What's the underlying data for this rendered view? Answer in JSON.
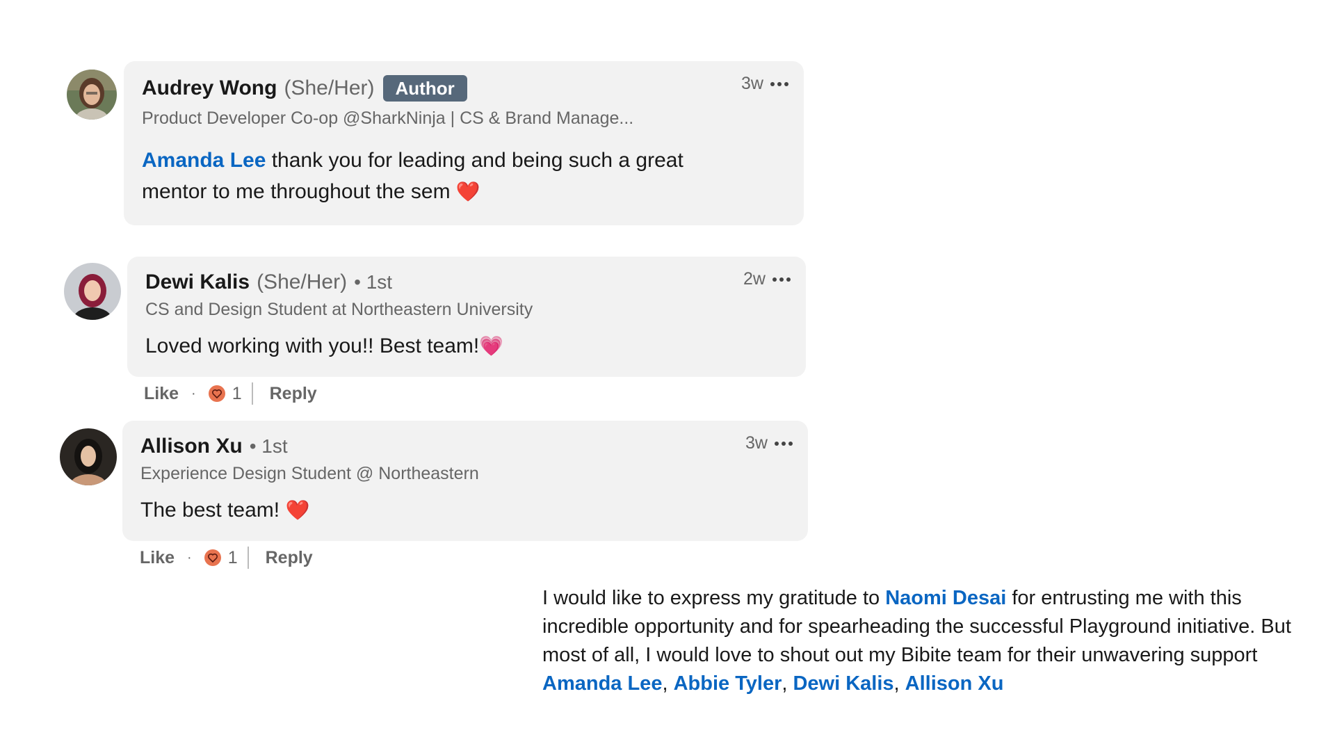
{
  "comments": [
    {
      "name": "Audrey Wong",
      "pronouns": "(She/Her)",
      "badge": "Author",
      "headline": "Product Developer Co-op @SharkNinja | CS & Brand Manage...",
      "time": "3w",
      "mention": "Amanda Lee",
      "text_line1": " thank you for leading and being such a great",
      "text_line2": "mentor to me throughout the sem ",
      "emoji": "❤️"
    },
    {
      "name": "Dewi Kalis",
      "pronouns": "(She/Her)",
      "degree": "• 1st",
      "headline": "CS and Design Student at Northeastern University",
      "time": "2w",
      "text": "Loved working with you!! Best team!",
      "emoji": "💗",
      "like_label": "Like",
      "dot": "·",
      "reaction_count": "1",
      "reply_label": "Reply"
    },
    {
      "name": "Allison Xu",
      "degree": "• 1st",
      "headline": "Experience Design Student @ Northeastern",
      "time": "3w",
      "text": "The best team! ",
      "emoji": "❤️",
      "like_label": "Like",
      "dot": "·",
      "reaction_count": "1",
      "reply_label": "Reply"
    }
  ],
  "post": {
    "part1": "I would like to express my gratitude to ",
    "mention1": "Naomi Desai",
    "part2": " for entrusting me with this incredible opportunity and for spearheading the successful Playground initiative. But most of all, I would love to shout out my Bibite team for their unwavering support ",
    "mentions": [
      "Amanda Lee",
      "Abbie Tyler",
      "Dewi Kalis",
      "Allison Xu"
    ],
    "separator": ", "
  },
  "colors": {
    "mention": "#0a66c2",
    "card_bg": "#f2f2f2",
    "badge_bg": "#56687a",
    "reaction": "#e8734f"
  },
  "icons": [
    "avatar-audrey",
    "avatar-dewi",
    "avatar-allison",
    "more-options-icon",
    "love-reaction-icon"
  ]
}
